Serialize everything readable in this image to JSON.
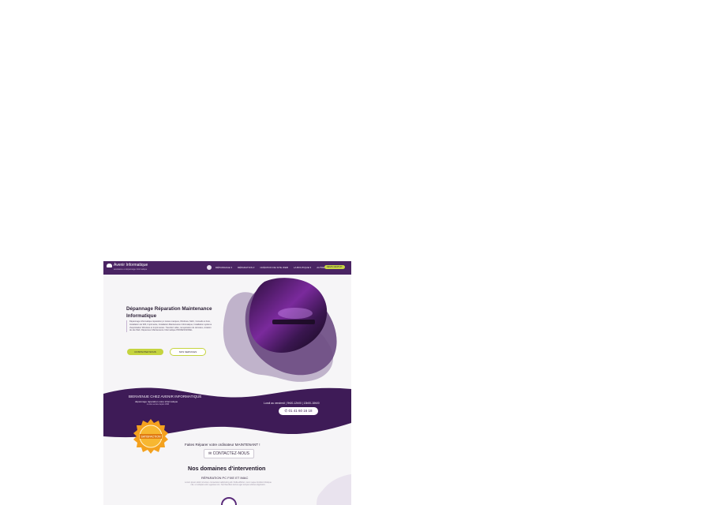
{
  "nav": {
    "logo_text": "Avenir Informatique",
    "logo_sub": "assistance et dépannage informatique",
    "menu": [
      "DÉPANNAGE ▾",
      "RÉPARATION ▾",
      "CRÉATION DE SITE WEB",
      "LA BOUTIQUE ▾",
      "AUTRES SERVICES ▾"
    ],
    "cta": "DEVIS GRATUIT"
  },
  "hero": {
    "title": "Dépannage Réparation Maintenance Informatique",
    "text": "Dépannage informatique réparation pc toutes marques, Windows, MAC, Conseils et Avis, Installation de Wifi, Imprimante, Installation Maintenance Informatique, Installation système d'exploitation Windows et Imprimantes. Transfert vidéo, récupération de données, création de site Web. Dépanneur Maintenance Informatique PROFESSIONEL.",
    "btn_contact": "CONTACTEZ NOUS",
    "btn_services": "NOS SERVICES"
  },
  "welcome": {
    "title": "BIENVENUE CHEZ AVENIR INFORMATIQUE",
    "subtitle": "dépannage réparation votre informatique",
    "since": "à votre service depuis 1996",
    "hours": "Lundi au vendredi | 9h00-12h00 | 13h00-18h00",
    "phone": "01 41 60 16 18"
  },
  "badge": {
    "text": "SATISFACTION"
  },
  "cta": {
    "line": "Faites Réparer votre ordinateur MAINTENANT !",
    "contact": "CONTACTEZ-NOUS"
  },
  "domains": {
    "title": "Nos domaines d'intervention",
    "repair_title": "RÉPARATION PC FIXE ET IMAC",
    "repair_text": "Lorem ipsum dolor sit amet, consectetur adipiscing elit. Nulla efficitur, nunc neque tincidunt tristique nisl, ut volutpat enim egestas non. Sed faucibus lectus eget tempus ultrices dignissim."
  },
  "colors": {
    "primary": "#4a2463",
    "accent": "#c8d744",
    "badge": "#f4a11e"
  }
}
